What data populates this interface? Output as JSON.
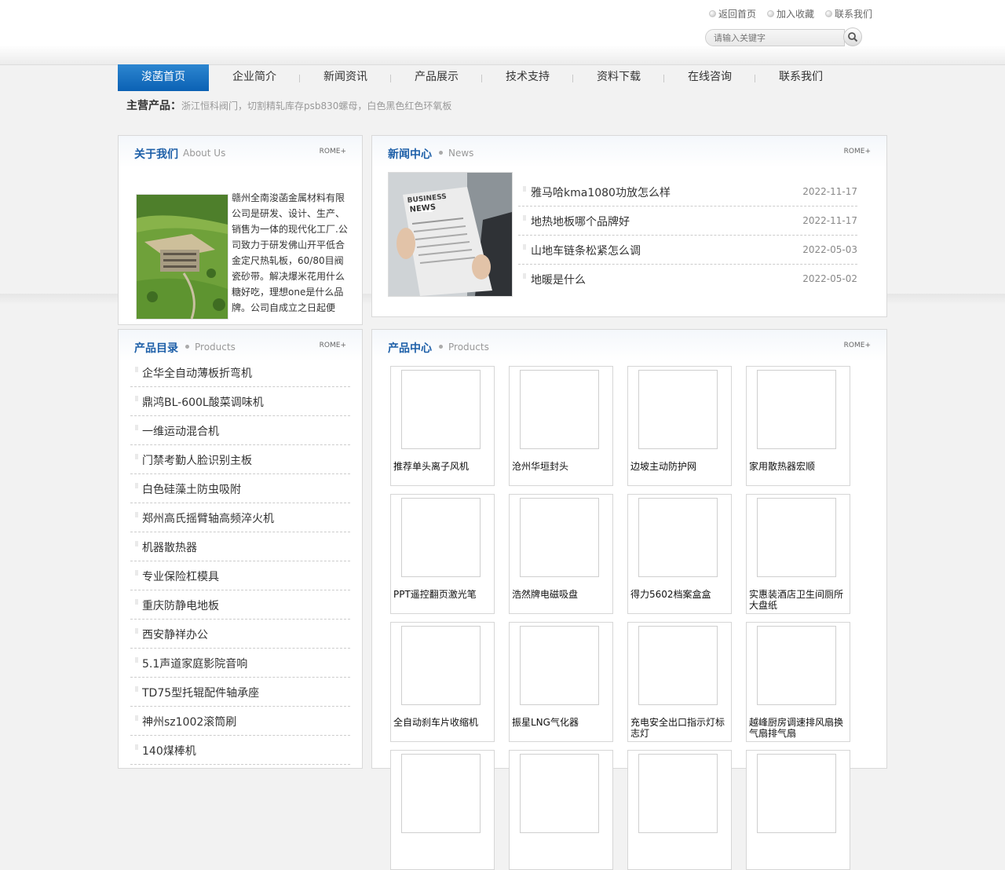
{
  "header": {
    "top_links": [
      {
        "label": "返回首页"
      },
      {
        "label": "加入收藏"
      },
      {
        "label": "联系我们"
      }
    ],
    "search_placeholder": "请输入关键字"
  },
  "nav": {
    "items": [
      {
        "label": "浚菡首页"
      },
      {
        "label": "企业简介"
      },
      {
        "label": "新闻资讯"
      },
      {
        "label": "产品展示"
      },
      {
        "label": "技术支持"
      },
      {
        "label": "资料下载"
      },
      {
        "label": "在线咨询"
      },
      {
        "label": "联系我们"
      }
    ],
    "active_index": 0,
    "active_color": "#0b61b4"
  },
  "tagline": {
    "label": "主营产品：",
    "text": "浙江恒科阀门，切割精轧库存psb830螺母，白色黑色红色环氧板"
  },
  "about": {
    "title": "关于我们",
    "subtitle": "About Us",
    "more": "ROME+",
    "text": "赣州全南浚菡金属材料有限公司是研发、设计、生产、销售为一体的现代化工厂.公司致力于研发佛山开平低合金定尺热轧板，60/80目阀瓷砂带。解决爆米花用什么糖好吃，理想one是什么品牌。公司自成立之日起便"
  },
  "news": {
    "title": "新闻中心",
    "subtitle": "News",
    "more": "ROME+",
    "items": [
      {
        "title": "雅马哈kma1080功放怎么样",
        "date": "2022-11-17"
      },
      {
        "title": "地热地板哪个品牌好",
        "date": "2022-11-17"
      },
      {
        "title": "山地车链条松紧怎么调",
        "date": "2022-05-03"
      },
      {
        "title": "地暖是什么",
        "date": "2022-05-02"
      }
    ]
  },
  "catalog": {
    "title": "产品目录",
    "subtitle": "Products",
    "more": "ROME+",
    "items": [
      {
        "label": "企华全自动薄板折弯机"
      },
      {
        "label": "鼎鸿BL-600L酸菜调味机"
      },
      {
        "label": "一维运动混合机"
      },
      {
        "label": "门禁考勤人脸识别主板"
      },
      {
        "label": "白色硅藻土防虫吸附"
      },
      {
        "label": "郑州高氏摇臂轴高频淬火机"
      },
      {
        "label": "机器散热器"
      },
      {
        "label": "专业保险杠模具"
      },
      {
        "label": "重庆防静电地板"
      },
      {
        "label": "西安静祥办公"
      },
      {
        "label": "5.1声道家庭影院音响"
      },
      {
        "label": "TD75型托辊配件轴承座"
      },
      {
        "label": "神州sz1002滚筒刷"
      },
      {
        "label": "140煤棒机"
      }
    ]
  },
  "products": {
    "title": "产品中心",
    "subtitle": "Products",
    "more": "ROME+",
    "items": [
      {
        "name": "推荐单头离子风机"
      },
      {
        "name": "沧州华垣封头"
      },
      {
        "name": "边坡主动防护网"
      },
      {
        "name": "家用散热器宏顺"
      },
      {
        "name": "PPT遥控翻页激光笔"
      },
      {
        "name": "浩然牌电磁吸盘"
      },
      {
        "name": "得力5602档案盒盒"
      },
      {
        "name": "实惠装酒店卫生间厕所大盘纸"
      },
      {
        "name": "全自动刹车片收缩机"
      },
      {
        "name": "振星LNG气化器"
      },
      {
        "name": "充电安全出口指示灯标志灯"
      },
      {
        "name": "越峰厨房调速排风扇换气扇排气扇"
      },
      {
        "name": ""
      },
      {
        "name": ""
      },
      {
        "name": ""
      },
      {
        "name": ""
      }
    ]
  },
  "colors": {
    "accent": "#1d5fa8",
    "nav_active": "#0b61b4"
  }
}
